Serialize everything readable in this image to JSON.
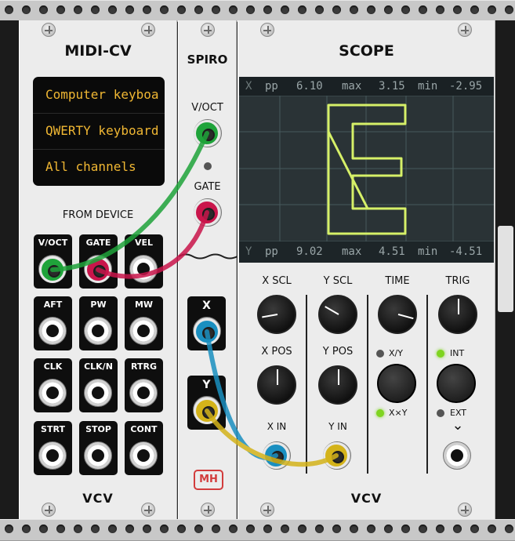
{
  "colors": {
    "green": "#1fa33a",
    "red": "#c9154b",
    "blue": "#1a8fc0",
    "yellow": "#d4b31a",
    "lcd_text": "#f0b733",
    "trace": "#d6f068",
    "led_green": "#7fd420",
    "led_off": "#555555"
  },
  "midicv": {
    "title": "MIDI-CV",
    "lcd": [
      "Computer keyboa",
      "QWERTY keyboard",
      "All channels"
    ],
    "from_device": "FROM DEVICE",
    "jacks": [
      "V/OCT",
      "GATE",
      "VEL",
      "AFT",
      "PW",
      "MW",
      "CLK",
      "CLK/N",
      "RTRG",
      "STRT",
      "STOP",
      "CONT"
    ],
    "logo": "VCV"
  },
  "spiro": {
    "title": "SPIRO",
    "voct": "V/OCT",
    "gate": "GATE",
    "x": "X",
    "y": "Y",
    "logo": "MH"
  },
  "scope": {
    "title": "SCOPE",
    "x_stats": {
      "ch": "X",
      "pp_label": "pp",
      "pp": "6.10",
      "max_label": "max",
      "max": "3.15",
      "min_label": "min",
      "min": "-2.95"
    },
    "y_stats": {
      "ch": "Y",
      "pp_label": "pp",
      "pp": "9.02",
      "max_label": "max",
      "max": "4.51",
      "min_label": "min",
      "min": "-4.51"
    },
    "labels": {
      "x_scl": "X SCL",
      "y_scl": "Y SCL",
      "time": "TIME",
      "trig": "TRIG",
      "x_pos": "X POS",
      "y_pos": "Y POS",
      "x_in": "X IN",
      "y_in": "Y IN"
    },
    "mode": {
      "xy": "X/Y",
      "xxy": "X×Y",
      "int": "INT",
      "ext": "EXT"
    },
    "chevron": "⌄",
    "logo": "VCV"
  }
}
